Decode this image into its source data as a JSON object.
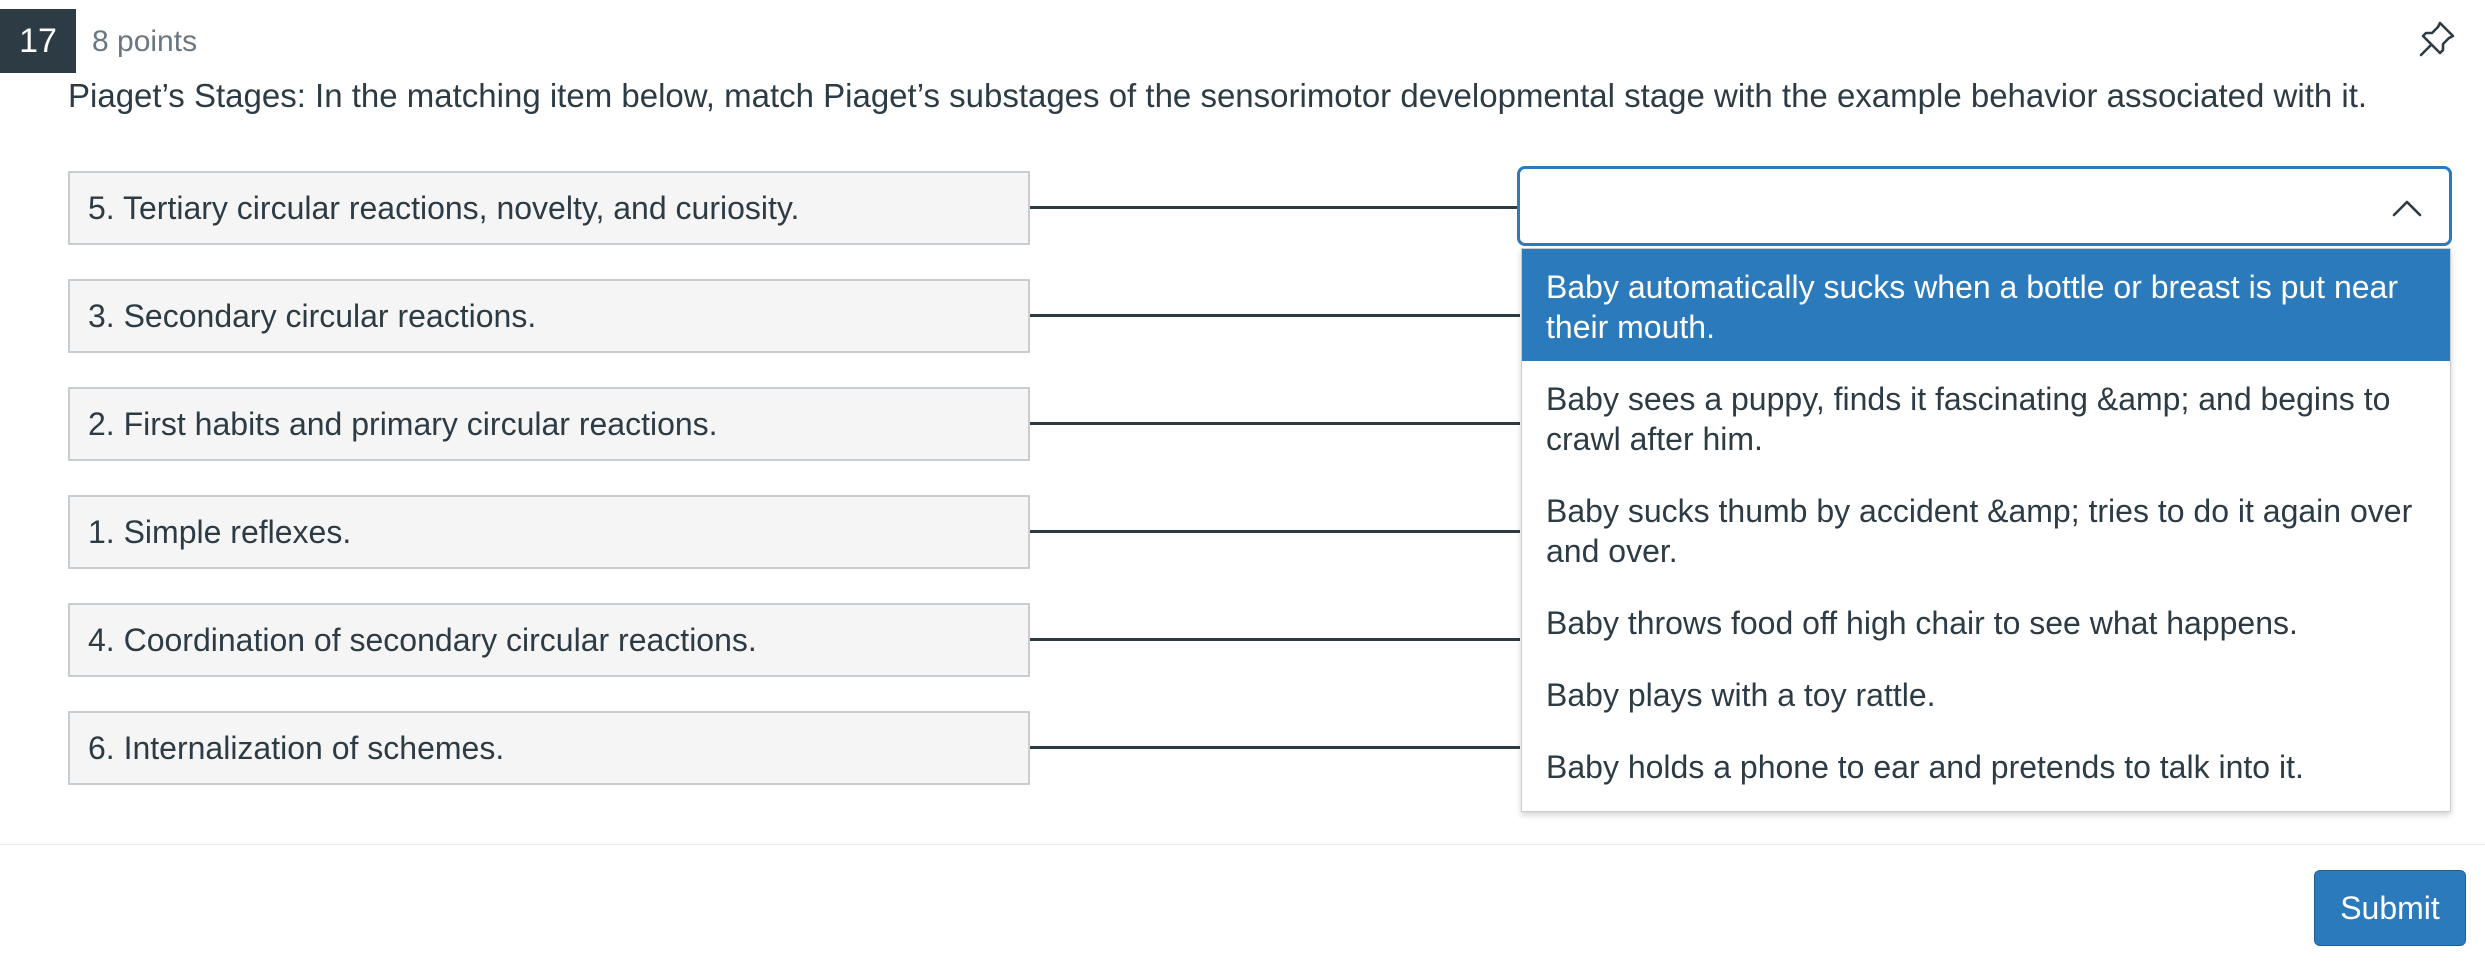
{
  "question": {
    "number": "17",
    "points": "8 points",
    "prompt": "Piaget’s Stages: In the matching item below, match Piaget’s substages of the sensorimotor developmental stage with the example behavior associated with it."
  },
  "matches": [
    {
      "label": "5. Tertiary circular reactions, novelty, and curiosity."
    },
    {
      "label": "3. Secondary circular reactions."
    },
    {
      "label": "2. First habits and primary circular reactions."
    },
    {
      "label": "1. Simple reflexes."
    },
    {
      "label": "4. Coordination of secondary circular reactions."
    },
    {
      "label": "6. Internalization of schemes."
    }
  ],
  "dropdown": {
    "selected_value": "",
    "highlighted_index": 0,
    "options": [
      "Baby automatically sucks when a bottle or breast is put near their mouth.",
      "Baby sees a puppy, finds it fascinating &amp; and begins to crawl after him.",
      "Baby sucks thumb by accident &amp; tries to do it again over and over.",
      "Baby throws food off high chair to see what happens.",
      "Baby plays with a toy rattle.",
      "Baby holds a phone to ear and pretends to talk into it."
    ]
  },
  "submit_label": "Submit",
  "colors": {
    "accent": "#2b7abc",
    "text": "#2d3b45",
    "badge_bg": "#2d3b45"
  },
  "icons": {
    "pin": "pin-icon",
    "chevron": "chevron-up-icon"
  }
}
